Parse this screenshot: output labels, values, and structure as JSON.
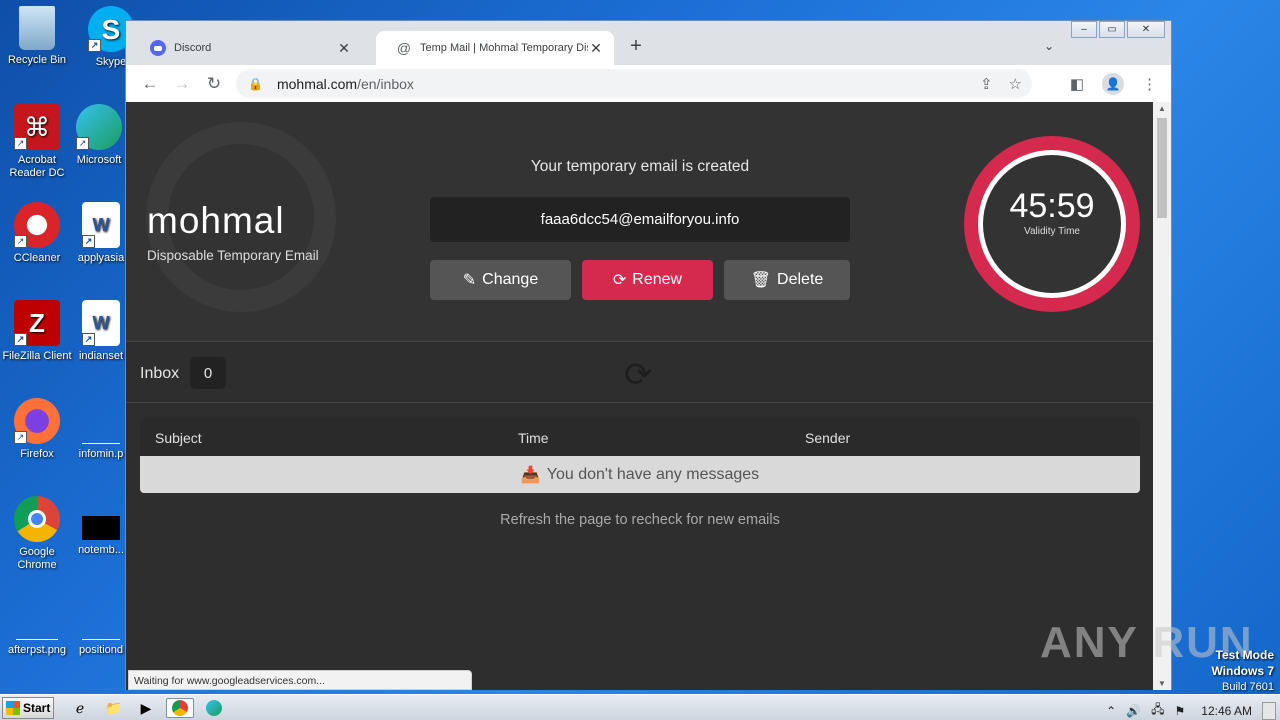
{
  "desktop": {
    "icons": [
      {
        "label": "Recycle Bin"
      },
      {
        "label": "Skype"
      },
      {
        "label": "Acrobat Reader DC"
      },
      {
        "label": "Microsoft"
      },
      {
        "label": "CCleaner"
      },
      {
        "label": "applyasia"
      },
      {
        "label": "FileZilla Client"
      },
      {
        "label": "indianset"
      },
      {
        "label": "Firefox"
      },
      {
        "label": "infomin.p"
      },
      {
        "label": "Google Chrome"
      },
      {
        "label": "notemb..."
      },
      {
        "label": "afterpst.png"
      },
      {
        "label": "positiond"
      }
    ]
  },
  "browser": {
    "tabs": [
      {
        "title": "Discord",
        "icon": "discord-icon"
      },
      {
        "title": "Temp Mail | Mohmal Temporary Dispo",
        "icon": "at-icon"
      }
    ],
    "url_host": "mohmal.com",
    "url_path": "/en/inbox",
    "status_text": "Waiting for www.googleadservices.com..."
  },
  "page": {
    "logo": "mohmal",
    "tagline": "Disposable Temporary Email",
    "headline": "Your temporary email is created",
    "email": "faaa6dcc54@emailforyou.info",
    "buttons": {
      "change": "Change",
      "renew": "Renew",
      "delete": "Delete"
    },
    "timer": {
      "value": "45:59",
      "label": "Validity Time"
    },
    "inbox": {
      "label": "Inbox",
      "count": "0"
    },
    "table": {
      "columns": [
        "Subject",
        "Time",
        "Sender"
      ],
      "empty_message": "You don't have any messages"
    },
    "hint": "Refresh the page to recheck for new emails"
  },
  "watermark": "ANY RUN",
  "system": {
    "test_mode": "Test Mode",
    "os": "Windows 7",
    "build": "Build 7601",
    "start_label": "Start",
    "clock": "12:46 AM"
  },
  "colors": {
    "accent": "#d5294d",
    "page_bg": "#2e2e2e",
    "desktop_bg": "#1c6fd6"
  }
}
